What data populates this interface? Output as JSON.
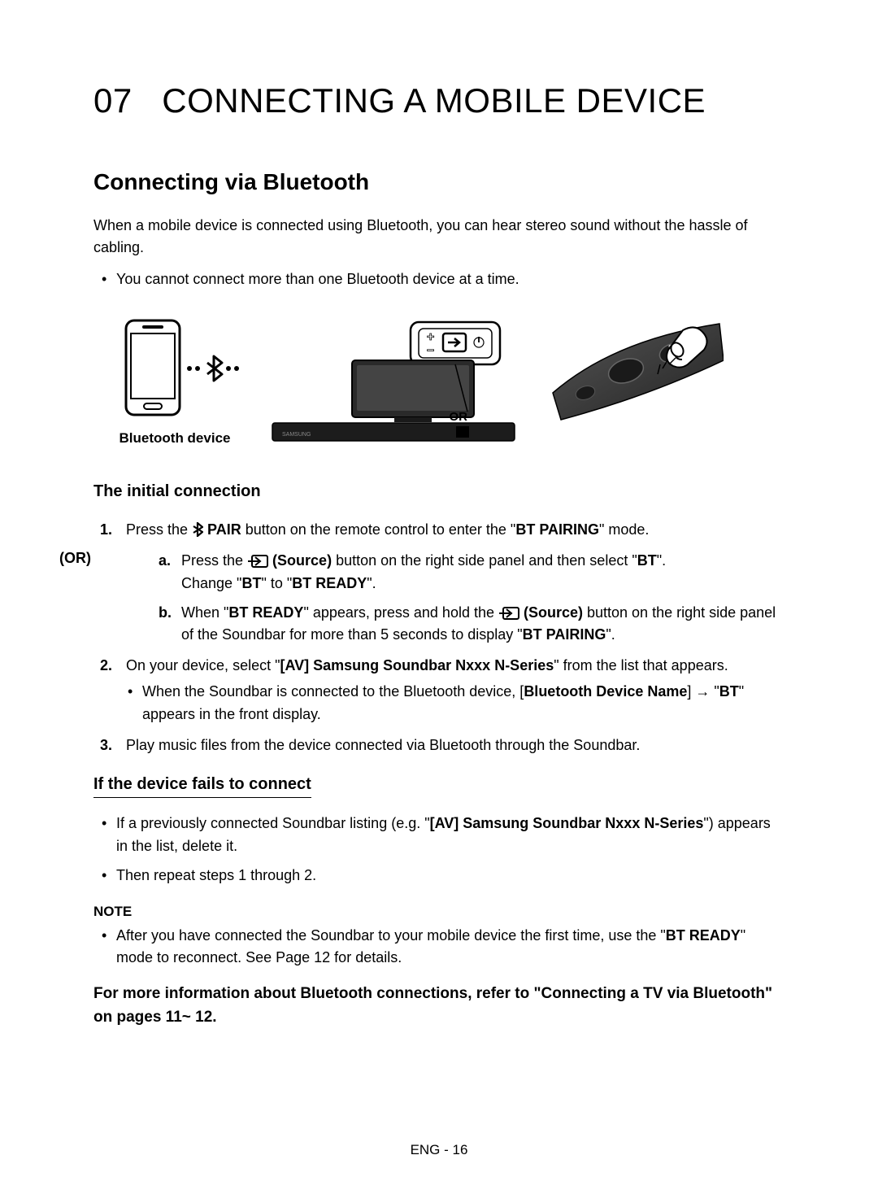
{
  "chapter": {
    "number": "07",
    "title": "CONNECTING A MOBILE DEVICE"
  },
  "section": {
    "title": "Connecting via Bluetooth"
  },
  "intro": "When a mobile device is connected using Bluetooth, you can hear stereo sound without the hassle of cabling.",
  "intro_bullet": "You cannot connect more than one Bluetooth device at a time.",
  "figure": {
    "phone_caption": "Bluetooth device",
    "or_label": "OR"
  },
  "initial": {
    "title": "The initial connection",
    "step1_a": "Press the ",
    "step1_pair": " PAIR",
    "step1_b": " button on the remote control to enter the \"",
    "step1_mode": "BT PAIRING",
    "step1_c": "\" mode.",
    "or_label": "(OR)",
    "sub_a_1": "Press the ",
    "sub_a_source": " (Source)",
    "sub_a_2": " button on the right side panel and then select \"",
    "sub_a_bt": "BT",
    "sub_a_3": "\".",
    "sub_a_change_1": "Change \"",
    "sub_a_change_bt": "BT",
    "sub_a_change_2": "\" to \"",
    "sub_a_change_ready": "BT READY",
    "sub_a_change_3": "\".",
    "sub_b_1": "When \"",
    "sub_b_ready": "BT READY",
    "sub_b_2": "\" appears, press and hold the ",
    "sub_b_source": " (Source)",
    "sub_b_3": " button on the right side panel of the Soundbar for more than 5 seconds to display \"",
    "sub_b_pairing": "BT PAIRING",
    "sub_b_4": "\".",
    "step2_a": "On your device, select \"",
    "step2_name": "[AV] Samsung Soundbar Nxxx N-Series",
    "step2_b": "\" from the list that appears.",
    "step2_bullet_a": "When the Soundbar is connected to the Bluetooth device, [",
    "step2_bullet_name": "Bluetooth Device Name",
    "step2_bullet_b": "] → \"",
    "step2_bullet_bt": "BT",
    "step2_bullet_c": "\" appears in the front display.",
    "step3": "Play music files from the device connected via Bluetooth through the Soundbar."
  },
  "fail": {
    "title": "If the device fails to connect",
    "bullet1_a": "If a previously connected Soundbar listing (e.g. \"",
    "bullet1_name": "[AV] Samsung Soundbar Nxxx N-Series",
    "bullet1_b": "\") appears in the list, delete it.",
    "bullet2": "Then repeat steps 1 through 2."
  },
  "note": {
    "title": "NOTE",
    "bullet_a": "After you have connected the Soundbar to your mobile device the first time, use the \"",
    "bullet_ready": "BT READY",
    "bullet_b": "\" mode to reconnect. See Page 12 for details."
  },
  "closing": "For more information about Bluetooth connections, refer to \"Connecting a TV via Bluetooth\" on pages 11~ 12.",
  "footer": "ENG - 16"
}
